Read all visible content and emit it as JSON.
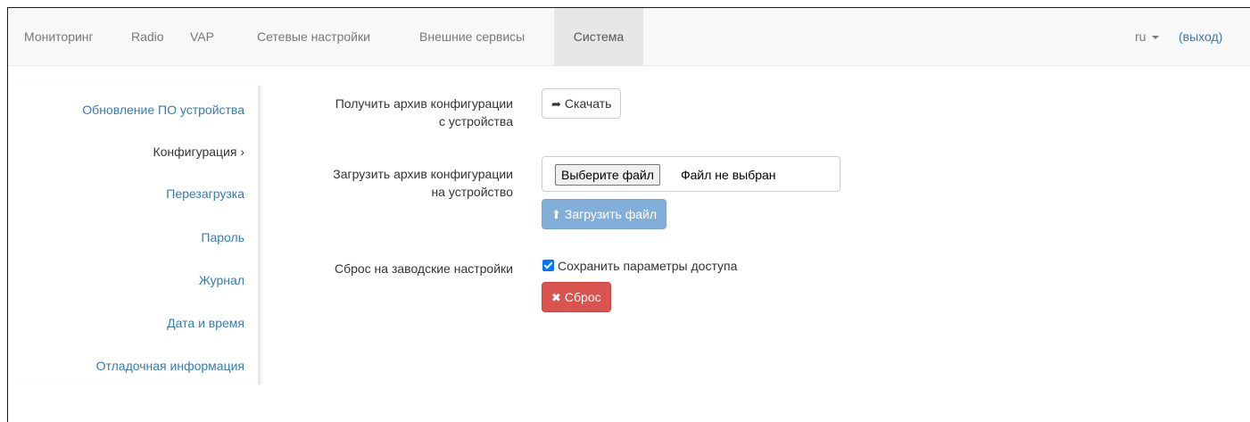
{
  "navbar": {
    "items": [
      {
        "label": "Мониторинг"
      },
      {
        "label": "Radio"
      },
      {
        "label": "VAP"
      },
      {
        "label": "Сетевые настройки"
      },
      {
        "label": "Внешние сервисы"
      },
      {
        "label": "Система",
        "active": true
      }
    ],
    "language": "ru",
    "logout": "(выход)"
  },
  "sidebar": {
    "items": [
      {
        "label": "Обновление ПО устройства"
      },
      {
        "label": "Конфигурация ›",
        "active": true
      },
      {
        "label": "Перезагрузка"
      },
      {
        "label": "Пароль"
      },
      {
        "label": "Журнал"
      },
      {
        "label": "Дата и время"
      },
      {
        "label": "Отладочная информация"
      }
    ]
  },
  "form": {
    "download": {
      "label_line1": "Получить архив конфигурации",
      "label_line2": "с устройства",
      "button": "Скачать",
      "icon": "share-arrow-icon"
    },
    "upload": {
      "label_line1": "Загрузить архив конфигурации",
      "label_line2": "на устройство",
      "file_button": "Выберите файл",
      "file_status": "Файл не выбран",
      "button": "Загрузить файл",
      "icon": "upload-icon"
    },
    "reset": {
      "label": "Сброс на заводские настройки",
      "checkbox_label": "Сохранить параметры доступа",
      "checkbox_checked": true,
      "button": "Сброс",
      "icon": "remove-icon"
    }
  },
  "colors": {
    "link": "#337ab7",
    "primary_disabled": "#81afd9",
    "danger": "#d9534f"
  }
}
